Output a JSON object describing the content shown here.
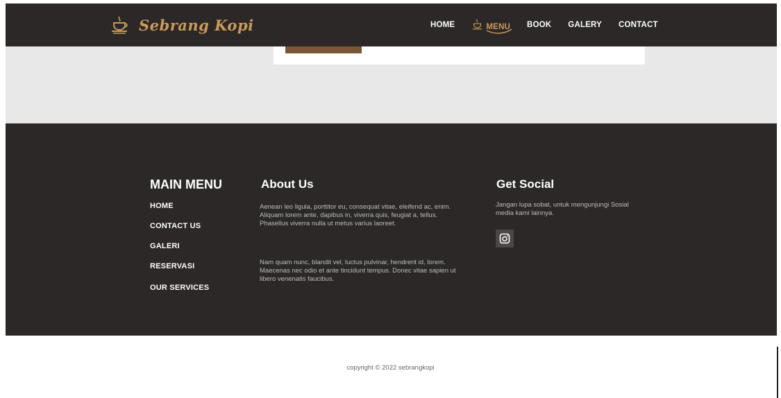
{
  "navbar": {
    "brand_name": "Sebrang Kopi",
    "links": [
      {
        "label": "HOME",
        "active": false
      },
      {
        "label": "MENU",
        "active": true
      },
      {
        "label": "BOOK",
        "active": false
      },
      {
        "label": "GALERY",
        "active": false
      },
      {
        "label": "CONTACT",
        "active": false
      }
    ]
  },
  "footer": {
    "main_menu": {
      "title": "MAIN MENU",
      "links": [
        "HOME",
        "CONTACT US",
        "GALERI",
        "RESERVASI",
        "OUR SERVICES"
      ]
    },
    "about": {
      "title": "About Us",
      "paragraph_1": "Aenean leo ligula, porttitor eu, consequat vitae, eleifend ac, enim. Aliquam lorem ante, dapibus in, viverra quis, feugiat a, tellus. Phasellus viverra nulla ut metus varius laoreet.",
      "paragraph_2": "Nam quam nunc, blandit vel, luctus pulvinar, hendrerit id, lorem. Maecenas nec odio et ante tincidunt tempus. Donec vitae sapien ut libero venenatis faucibus."
    },
    "social": {
      "title": "Get Social",
      "text": "Jangan lupa sobat, untuk mengunjungi Sosial media kami lainnya.",
      "icon": "instagram-icon"
    }
  },
  "copyright": "copyright © 2022 sebrangkopi",
  "colors": {
    "dark": "#2b2827",
    "accent": "#c99a5b",
    "light_section": "#e8e8e8"
  }
}
